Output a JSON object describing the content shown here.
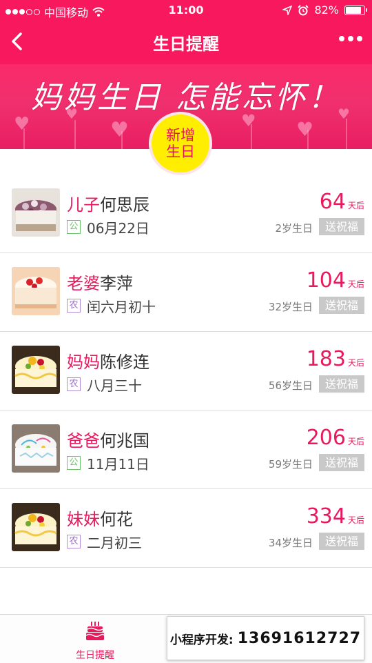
{
  "status_bar": {
    "carrier": "中国移动",
    "time": "11:00",
    "battery": "82%",
    "battery_level": 0.82
  },
  "nav": {
    "title": "生日提醒"
  },
  "banner": {
    "slogan": "妈妈生日 怎能忘怀！",
    "add_line1": "新增",
    "add_line2": "生日"
  },
  "list": [
    {
      "relation": "儿子",
      "name": "何思辰",
      "calendar": "公",
      "calendar_type": "solar",
      "date": "06月22日",
      "days": "64",
      "days_unit": "天后",
      "age": "2岁生日",
      "action": "送祝福"
    },
    {
      "relation": "老婆",
      "name": "李萍",
      "calendar": "农",
      "calendar_type": "lunar",
      "date": "闰六月初十",
      "days": "104",
      "days_unit": "天后",
      "age": "32岁生日",
      "action": "送祝福"
    },
    {
      "relation": "妈妈",
      "name": "陈修连",
      "calendar": "农",
      "calendar_type": "lunar",
      "date": "八月三十",
      "days": "183",
      "days_unit": "天后",
      "age": "56岁生日",
      "action": "送祝福"
    },
    {
      "relation": "爸爸",
      "name": "何兆国",
      "calendar": "公",
      "calendar_type": "solar",
      "date": "11月11日",
      "days": "206",
      "days_unit": "天后",
      "age": "59岁生日",
      "action": "送祝福"
    },
    {
      "relation": "妹妹",
      "name": "何花",
      "calendar": "农",
      "calendar_type": "lunar",
      "date": "二月初三",
      "days": "334",
      "days_unit": "天后",
      "age": "34岁生日",
      "action": "送祝福"
    }
  ],
  "tabbar": {
    "tab_birthday": "生日提醒"
  },
  "overlay": {
    "label": "小程序开发:",
    "phone": "13691612727"
  },
  "colors": {
    "primary": "#f8185d",
    "accent_yellow": "#ffee00",
    "solar_badge": "#69c46a",
    "lunar_badge": "#9b6ec9",
    "button_gray": "#c9c9c9"
  }
}
